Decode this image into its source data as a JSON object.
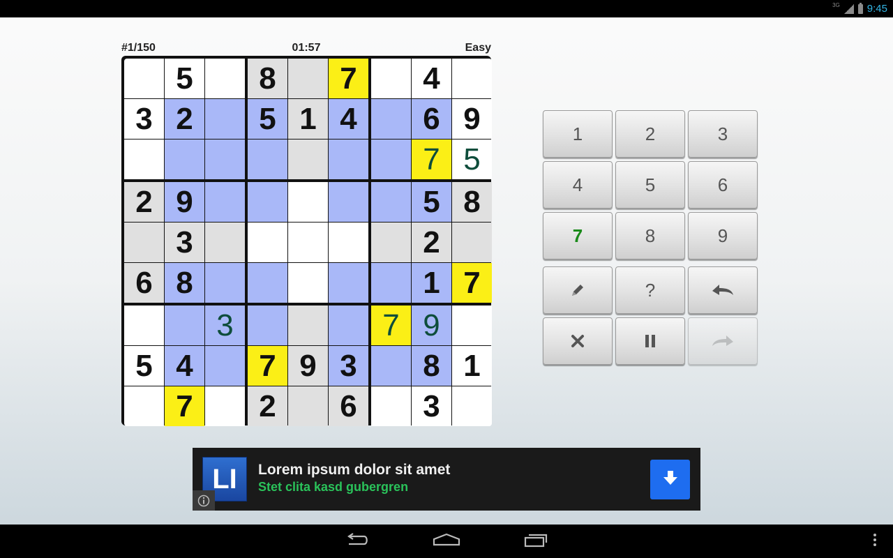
{
  "status_bar": {
    "time": "9:45",
    "network_label": "3G",
    "icons": [
      "signal-icon",
      "battery-icon"
    ]
  },
  "header": {
    "puzzle_number": "#1/150",
    "timer": "01:57",
    "difficulty": "Easy"
  },
  "board": {
    "selected_digit": "7",
    "colors": {
      "white": "#ffffff",
      "given_gray": "#e0e0e0",
      "highlight_blue": "#a9b8f8",
      "highlight_yellow": "#fbef16",
      "user_digit": "#0e4d3b"
    },
    "cells": [
      {
        "v": "",
        "bg": "w"
      },
      {
        "v": "5",
        "bg": "w"
      },
      {
        "v": "",
        "bg": "w"
      },
      {
        "v": "8",
        "bg": "g"
      },
      {
        "v": "",
        "bg": "g"
      },
      {
        "v": "7",
        "bg": "y"
      },
      {
        "v": "",
        "bg": "w"
      },
      {
        "v": "4",
        "bg": "w"
      },
      {
        "v": "",
        "bg": "w"
      },
      {
        "v": "3",
        "bg": "w"
      },
      {
        "v": "2",
        "bg": "b"
      },
      {
        "v": "",
        "bg": "b"
      },
      {
        "v": "5",
        "bg": "b"
      },
      {
        "v": "1",
        "bg": "g"
      },
      {
        "v": "4",
        "bg": "b"
      },
      {
        "v": "",
        "bg": "b"
      },
      {
        "v": "6",
        "bg": "b"
      },
      {
        "v": "9",
        "bg": "w"
      },
      {
        "v": "",
        "bg": "w"
      },
      {
        "v": "",
        "bg": "b"
      },
      {
        "v": "",
        "bg": "b"
      },
      {
        "v": "",
        "bg": "b"
      },
      {
        "v": "",
        "bg": "g"
      },
      {
        "v": "",
        "bg": "b"
      },
      {
        "v": "",
        "bg": "b"
      },
      {
        "v": "7",
        "bg": "y",
        "user": true
      },
      {
        "v": "5",
        "bg": "w",
        "user": true
      },
      {
        "v": "2",
        "bg": "g"
      },
      {
        "v": "9",
        "bg": "b"
      },
      {
        "v": "",
        "bg": "b"
      },
      {
        "v": "",
        "bg": "b"
      },
      {
        "v": "",
        "bg": "w"
      },
      {
        "v": "",
        "bg": "b"
      },
      {
        "v": "",
        "bg": "b"
      },
      {
        "v": "5",
        "bg": "b"
      },
      {
        "v": "8",
        "bg": "g"
      },
      {
        "v": "",
        "bg": "g"
      },
      {
        "v": "3",
        "bg": "g"
      },
      {
        "v": "",
        "bg": "g"
      },
      {
        "v": "",
        "bg": "w"
      },
      {
        "v": "",
        "bg": "w"
      },
      {
        "v": "",
        "bg": "w"
      },
      {
        "v": "",
        "bg": "g"
      },
      {
        "v": "2",
        "bg": "g"
      },
      {
        "v": "",
        "bg": "g"
      },
      {
        "v": "6",
        "bg": "g"
      },
      {
        "v": "8",
        "bg": "b"
      },
      {
        "v": "",
        "bg": "b"
      },
      {
        "v": "",
        "bg": "b"
      },
      {
        "v": "",
        "bg": "w"
      },
      {
        "v": "",
        "bg": "b"
      },
      {
        "v": "",
        "bg": "b"
      },
      {
        "v": "1",
        "bg": "b"
      },
      {
        "v": "7",
        "bg": "y"
      },
      {
        "v": "",
        "bg": "w"
      },
      {
        "v": "",
        "bg": "b"
      },
      {
        "v": "3",
        "bg": "b",
        "user": true
      },
      {
        "v": "",
        "bg": "b"
      },
      {
        "v": "",
        "bg": "g"
      },
      {
        "v": "",
        "bg": "b"
      },
      {
        "v": "7",
        "bg": "y",
        "user": true
      },
      {
        "v": "9",
        "bg": "b",
        "user": true
      },
      {
        "v": "",
        "bg": "w"
      },
      {
        "v": "5",
        "bg": "w"
      },
      {
        "v": "4",
        "bg": "b"
      },
      {
        "v": "",
        "bg": "b"
      },
      {
        "v": "7",
        "bg": "y"
      },
      {
        "v": "9",
        "bg": "g"
      },
      {
        "v": "3",
        "bg": "b"
      },
      {
        "v": "",
        "bg": "b"
      },
      {
        "v": "8",
        "bg": "b"
      },
      {
        "v": "1",
        "bg": "w"
      },
      {
        "v": "",
        "bg": "w"
      },
      {
        "v": "7",
        "bg": "y"
      },
      {
        "v": "",
        "bg": "w"
      },
      {
        "v": "2",
        "bg": "g"
      },
      {
        "v": "",
        "bg": "g"
      },
      {
        "v": "6",
        "bg": "g"
      },
      {
        "v": "",
        "bg": "w"
      },
      {
        "v": "3",
        "bg": "w"
      },
      {
        "v": "",
        "bg": "w"
      }
    ]
  },
  "keypad": {
    "digits": [
      "1",
      "2",
      "3",
      "4",
      "5",
      "6",
      "7",
      "8",
      "9"
    ],
    "selected": "7",
    "controls": [
      "pencil-icon",
      "hint-icon",
      "undo-icon",
      "clear-icon",
      "pause-icon",
      "redo-icon"
    ],
    "hint_label": "?",
    "disabled": [
      "redo-icon"
    ]
  },
  "ad": {
    "logo_text": "LI",
    "title": "Lorem ipsum dolor sit amet",
    "subtitle": "Stet clita kasd gubergren",
    "icons": [
      "info-icon",
      "download-icon"
    ]
  },
  "nav_bar": {
    "icons": [
      "back-icon",
      "home-icon",
      "recent-apps-icon",
      "menu-icon"
    ]
  }
}
